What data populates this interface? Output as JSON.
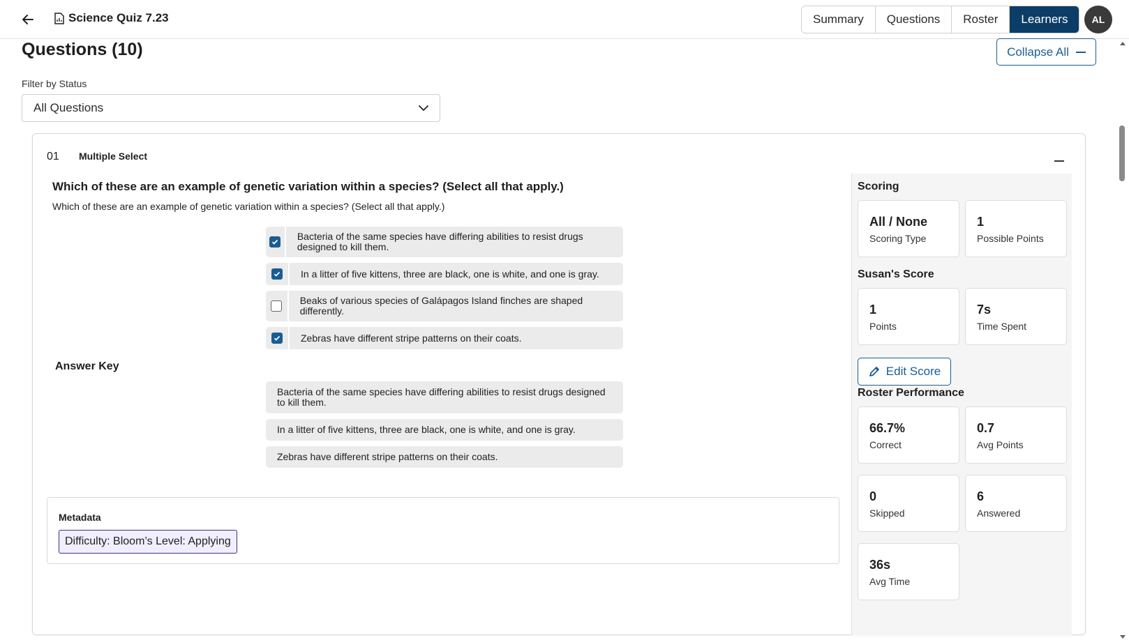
{
  "header": {
    "title": "Science Quiz 7.23",
    "tabs": [
      "Summary",
      "Questions",
      "Roster",
      "Learners"
    ],
    "active_tab": "Learners",
    "avatar_initials": "AL"
  },
  "questions": {
    "heading": "Questions (10)",
    "collapse_all_label": "Collapse All",
    "filter_label": "Filter by Status",
    "filter_value": "All Questions"
  },
  "question": {
    "number": "01",
    "type": "Multiple Select",
    "title": "Which of these are an example of genetic variation within a species? (Select all that apply.)",
    "text": "Which of these are an example of genetic variation within a species? (Select all that apply.)",
    "choices": [
      {
        "text": "Bacteria of the same species have differing abilities to resist drugs designed to kill them.",
        "checked": true
      },
      {
        "text": "In a litter of five kittens, three are black, one is white, and one is gray.",
        "checked": true
      },
      {
        "text": "Beaks of various species of Galápagos Island finches are shaped differently.",
        "checked": false
      },
      {
        "text": "Zebras have different stripe patterns on their coats.",
        "checked": true
      }
    ],
    "answer_key_label": "Answer Key",
    "answer_key": [
      "Bacteria of the same species have differing abilities to resist drugs designed to kill them.",
      "In a litter of five kittens, three are black, one is white, and one is gray.",
      "Zebras have different stripe patterns on their coats."
    ],
    "metadata_label": "Metadata",
    "metadata_tag": "Difficulty: Bloom’s Level: Applying"
  },
  "side": {
    "scoring_heading": "Scoring",
    "scoring_type_value": "All / None",
    "scoring_type_label": "Scoring Type",
    "possible_points_value": "1",
    "possible_points_label": "Possible Points",
    "learner_heading": "Susan's Score",
    "points_value": "1",
    "points_label": "Points",
    "time_spent_value": "7s",
    "time_spent_label": "Time Spent",
    "edit_score_label": "Edit Score",
    "roster_heading": "Roster Performance",
    "correct_value": "66.7%",
    "correct_label": "Correct",
    "avg_points_value": "0.7",
    "avg_points_label": "Avg Points",
    "skipped_value": "0",
    "skipped_label": "Skipped",
    "answered_value": "6",
    "answered_label": "Answered",
    "avg_time_value": "36s",
    "avg_time_label": "Avg Time"
  },
  "colors": {
    "accent": "#1a5d92",
    "active_tab_bg": "#0b3d66",
    "tag_border": "#3b2d8f",
    "tag_bg": "#f0eeff"
  }
}
